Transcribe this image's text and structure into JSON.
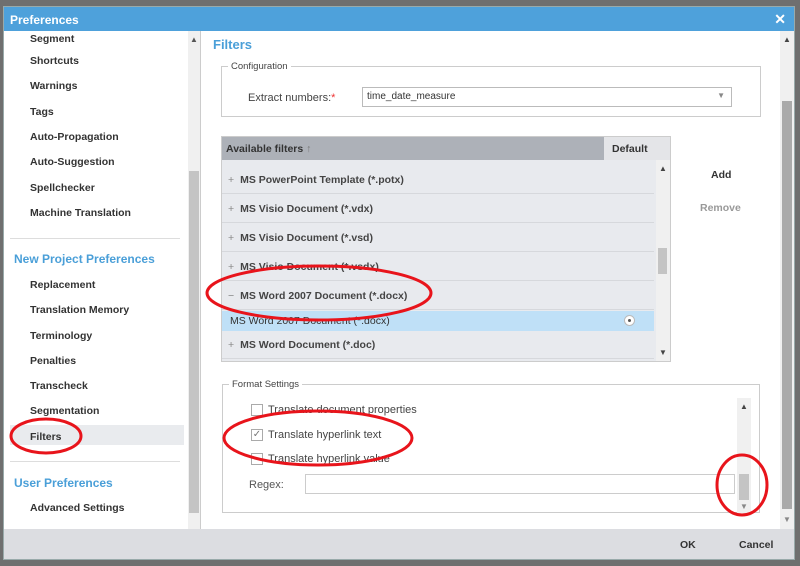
{
  "window": {
    "title": "Preferences",
    "close_icon": "close-icon"
  },
  "sidebar": {
    "items_top": [
      "Segment",
      "Shortcuts",
      "Warnings",
      "Tags",
      "Auto-Propagation",
      "Auto-Suggestion",
      "Spellchecker",
      "Machine Translation"
    ],
    "new_project_heading": "New Project Preferences",
    "new_project_items": [
      "Replacement",
      "Translation Memory",
      "Terminology",
      "Penalties",
      "Transcheck",
      "Segmentation",
      "Filters"
    ],
    "user_heading": "User Preferences",
    "user_items": [
      "Advanced Settings"
    ],
    "selected": "Filters"
  },
  "main": {
    "title": "Filters",
    "configuration": {
      "legend": "Configuration",
      "extract_label": "Extract numbers:",
      "required_mark": "*",
      "extract_value": "time_date_measure"
    },
    "filters_table": {
      "col_name": "Available filters",
      "sort_icon": "sort-up-arrow",
      "col_default": "Default",
      "rows": [
        {
          "expander": "+",
          "label": "MS PowerPoint Template (*.potx)"
        },
        {
          "expander": "+",
          "label": "MS Visio Document (*.vdx)"
        },
        {
          "expander": "+",
          "label": "MS Visio Document (*.vsd)"
        },
        {
          "expander": "+",
          "label": "MS Visio Document (*.vsdx)"
        },
        {
          "expander": "−",
          "label": "MS Word 2007 Document (*.docx)"
        }
      ],
      "child": {
        "label": "MS Word 2007 Document (*.docx)",
        "default": true
      },
      "next_row": {
        "expander": "+",
        "label": "MS Word Document (*.doc)"
      }
    },
    "add_label": "Add",
    "remove_label": "Remove",
    "format": {
      "legend": "Format Settings",
      "options": [
        {
          "label": "Translate document properties",
          "checked": false
        },
        {
          "label": "Translate hyperlink text",
          "checked": true
        },
        {
          "label": "Translate hyperlink value",
          "checked": false
        }
      ],
      "regex_label": "Regex:",
      "regex_value": ""
    }
  },
  "footer": {
    "ok": "OK",
    "cancel": "Cancel"
  },
  "colors": {
    "titlebar": "#4ea1db",
    "accent": "#4a9fd8",
    "selected_row": "#bfe0f7",
    "annotation": "#e8141b"
  }
}
